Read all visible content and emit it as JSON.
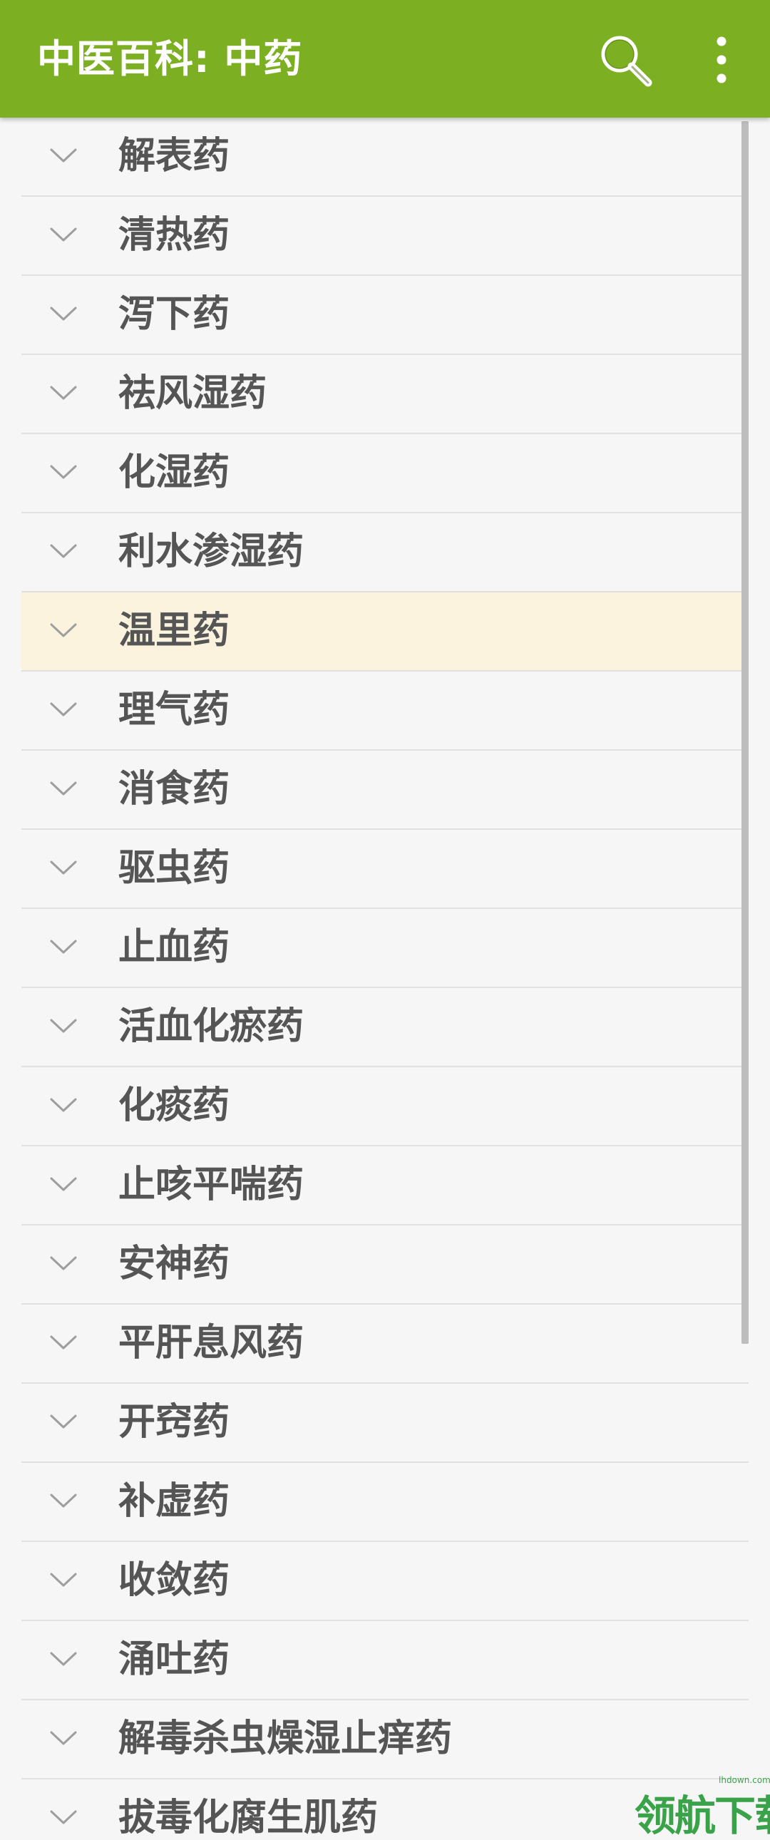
{
  "app_bar": {
    "title": "中医百科: 中药",
    "search_icon": "search-icon",
    "more_icon": "more-vertical-icon",
    "background": "#7cb022"
  },
  "list": {
    "items": [
      {
        "label": "解表药",
        "highlighted": false
      },
      {
        "label": "清热药",
        "highlighted": false
      },
      {
        "label": "泻下药",
        "highlighted": false
      },
      {
        "label": "祛风湿药",
        "highlighted": false
      },
      {
        "label": "化湿药",
        "highlighted": false
      },
      {
        "label": "利水渗湿药",
        "highlighted": false
      },
      {
        "label": "温里药",
        "highlighted": true
      },
      {
        "label": "理气药",
        "highlighted": false
      },
      {
        "label": "消食药",
        "highlighted": false
      },
      {
        "label": "驱虫药",
        "highlighted": false
      },
      {
        "label": "止血药",
        "highlighted": false
      },
      {
        "label": "活血化瘀药",
        "highlighted": false
      },
      {
        "label": "化痰药",
        "highlighted": false
      },
      {
        "label": "止咳平喘药",
        "highlighted": false
      },
      {
        "label": "安神药",
        "highlighted": false
      },
      {
        "label": "平肝息风药",
        "highlighted": false
      },
      {
        "label": "开窍药",
        "highlighted": false
      },
      {
        "label": "补虚药",
        "highlighted": false
      },
      {
        "label": "收敛药",
        "highlighted": false
      },
      {
        "label": "涌吐药",
        "highlighted": false
      },
      {
        "label": "解毒杀虫燥湿止痒药",
        "highlighted": false
      },
      {
        "label": "拔毒化腐生肌药",
        "highlighted": false
      }
    ],
    "expand_icon": "chevron-down-icon",
    "highlight_color": "#fbf3de"
  },
  "watermark": {
    "text": "领航下载",
    "small_text": "lhdown.com"
  }
}
